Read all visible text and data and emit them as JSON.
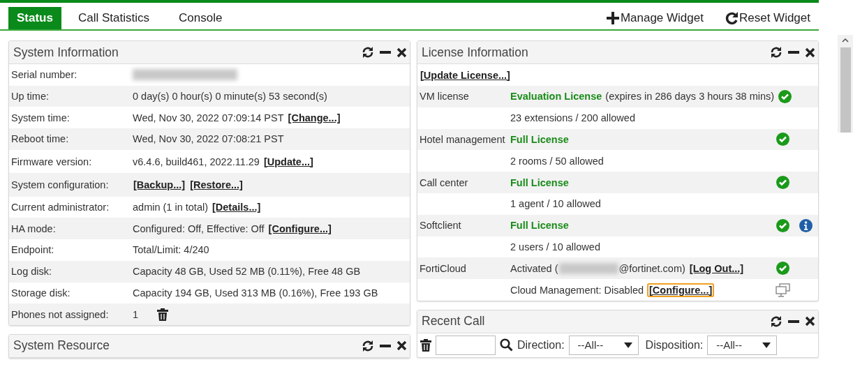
{
  "tabs": [
    {
      "label": "Status",
      "selected": true
    },
    {
      "label": "Call Statistics",
      "selected": false
    },
    {
      "label": "Console",
      "selected": false
    }
  ],
  "widget_actions": [
    {
      "kind": "add",
      "label": "Manage Widget"
    },
    {
      "kind": "reset",
      "label": "Reset Widget"
    }
  ],
  "system_information": {
    "title": "System Information",
    "rows": [
      {
        "label": "Serial number:",
        "parts": [
          {
            "kind": "redacted"
          }
        ]
      },
      {
        "label": "Up time:",
        "parts": [
          {
            "kind": "text",
            "text": "0 day(s) 0 hour(s) 0 minute(s) 53 second(s)"
          }
        ]
      },
      {
        "label": "System time:",
        "parts": [
          {
            "kind": "text",
            "text": "Wed, Nov 30, 2022 07:09:14 PST"
          },
          {
            "kind": "link",
            "text": "[Change...]"
          }
        ]
      },
      {
        "label": "Reboot time:",
        "parts": [
          {
            "kind": "text",
            "text": "Wed, Nov 30, 2022 07:08:21 PST"
          }
        ]
      },
      {
        "label": "Firmware version:",
        "parts": [
          {
            "kind": "text",
            "text": "v6.4.6, build461, 2022.11.29"
          },
          {
            "kind": "link",
            "text": "[Update...]"
          }
        ]
      },
      {
        "label": "System configuration:",
        "parts": [
          {
            "kind": "link",
            "text": "[Backup...]"
          },
          {
            "kind": "link",
            "text": "[Restore...]"
          }
        ]
      },
      {
        "label": "Current administrator:",
        "parts": [
          {
            "kind": "text",
            "text": "admin (1 in total)"
          },
          {
            "kind": "link",
            "text": "[Details...]"
          }
        ]
      },
      {
        "label": "HA mode:",
        "parts": [
          {
            "kind": "text",
            "text": "Configured: Off,  Effective:  Off"
          },
          {
            "kind": "link",
            "text": "[Configure...]"
          }
        ]
      },
      {
        "label": "Endpoint:",
        "parts": [
          {
            "kind": "text",
            "text": "Total/Limit: 4/240"
          }
        ]
      },
      {
        "label": "Log disk:",
        "parts": [
          {
            "kind": "text",
            "text": "Capacity 48 GB, Used 52 MB (0.11%), Free 48 GB"
          }
        ]
      },
      {
        "label": "Storage disk:",
        "parts": [
          {
            "kind": "text",
            "text": "Capacity 194 GB, Used 313 MB (0.16%), Free 193 GB"
          }
        ]
      },
      {
        "label": "Phones not assigned:",
        "parts": [
          {
            "kind": "text",
            "text": "1"
          },
          {
            "kind": "trash"
          }
        ]
      }
    ]
  },
  "system_resource": {
    "title": "System Resource"
  },
  "license_information": {
    "title": "License Information",
    "update_link": "[Update License...]",
    "rows": [
      {
        "label": "VM license",
        "parts": [
          {
            "kind": "license",
            "text": "Evaluation License"
          },
          {
            "kind": "text",
            "text": "(expires in 286 days 3 hours 38 mins)"
          }
        ],
        "verified": true,
        "screen": false,
        "info": false
      },
      {
        "parts": [
          {
            "kind": "text",
            "text": "23 extensions / 200 allowed"
          }
        ],
        "verified": false,
        "screen": false,
        "info": false
      },
      {
        "label": "Hotel management",
        "parts": [
          {
            "kind": "license",
            "text": "Full License"
          }
        ],
        "verified": true,
        "screen": false,
        "info": false
      },
      {
        "parts": [
          {
            "kind": "text",
            "text": "2 rooms / 50 allowed"
          }
        ],
        "verified": false,
        "screen": false,
        "info": false
      },
      {
        "label": "Call center",
        "parts": [
          {
            "kind": "license",
            "text": "Full License"
          }
        ],
        "verified": true,
        "screen": false,
        "info": false
      },
      {
        "parts": [
          {
            "kind": "text",
            "text": "1 agent / 10 allowed"
          }
        ],
        "verified": false,
        "screen": false,
        "info": false
      },
      {
        "label": "Softclient",
        "parts": [
          {
            "kind": "license",
            "text": "Full License"
          }
        ],
        "verified": true,
        "screen": false,
        "info": true
      },
      {
        "parts": [
          {
            "kind": "text",
            "text": "2 users / 10 allowed"
          }
        ],
        "verified": false,
        "screen": false,
        "info": false
      },
      {
        "label": "FortiCloud",
        "parts": [
          {
            "kind": "text",
            "text": "Activated ("
          },
          {
            "kind": "redacted"
          },
          {
            "kind": "text",
            "text": "@fortinet.com)"
          },
          {
            "kind": "link",
            "text": "[Log Out...]"
          }
        ],
        "verified": true,
        "screen": false,
        "info": false
      },
      {
        "parts": [
          {
            "kind": "text",
            "text": "Cloud Management: Disabled"
          },
          {
            "kind": "link",
            "text": "[Configure...]",
            "focused": true
          }
        ],
        "verified": false,
        "screen": true,
        "info": false
      }
    ]
  },
  "recent_call": {
    "title": "Recent Call",
    "filters": [
      {
        "label": "Direction:",
        "value": "--All--"
      },
      {
        "label": "Disposition:",
        "value": "--All--"
      }
    ]
  }
}
